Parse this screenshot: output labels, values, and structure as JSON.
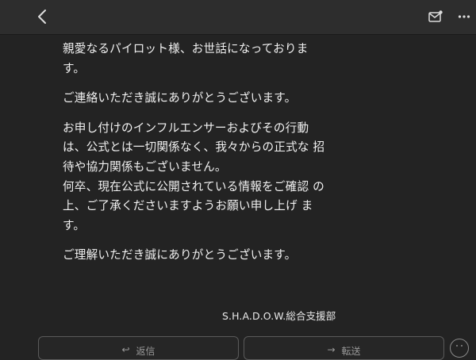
{
  "header": {
    "back_icon": "chevron-left-icon",
    "mail_icon": "mail-unread-icon",
    "more_icon": "more-horizontal-icon"
  },
  "message": {
    "paragraphs": [
      "親愛なるパイロット様、お世話になっておりま す。",
      "ご連絡いただき誠にありがとうございます。",
      "お申し付けのインフルエンサーおよびその行動 は、公式とは一切関係なく、我々からの正式な 招待や協力関係もございません。",
      "何卒、現在公式に公開されている情報をご確認 の上、ご了承くださいますようお願い申し上げ ます。",
      "ご理解いただき誠にありがとうございます。"
    ],
    "signature": "S.H.A.D.O.W.総合支援部"
  },
  "actions": {
    "reply_label": "返信",
    "forward_label": "転送",
    "reply_icon": "reply-arrow-icon",
    "forward_icon": "forward-arrow-icon",
    "emoji_icon": "smiley-icon"
  },
  "colors": {
    "background": "#232323",
    "topbar": "#2d2d2d",
    "text": "#f1f1f1",
    "button_border": "#5a5a5a"
  }
}
